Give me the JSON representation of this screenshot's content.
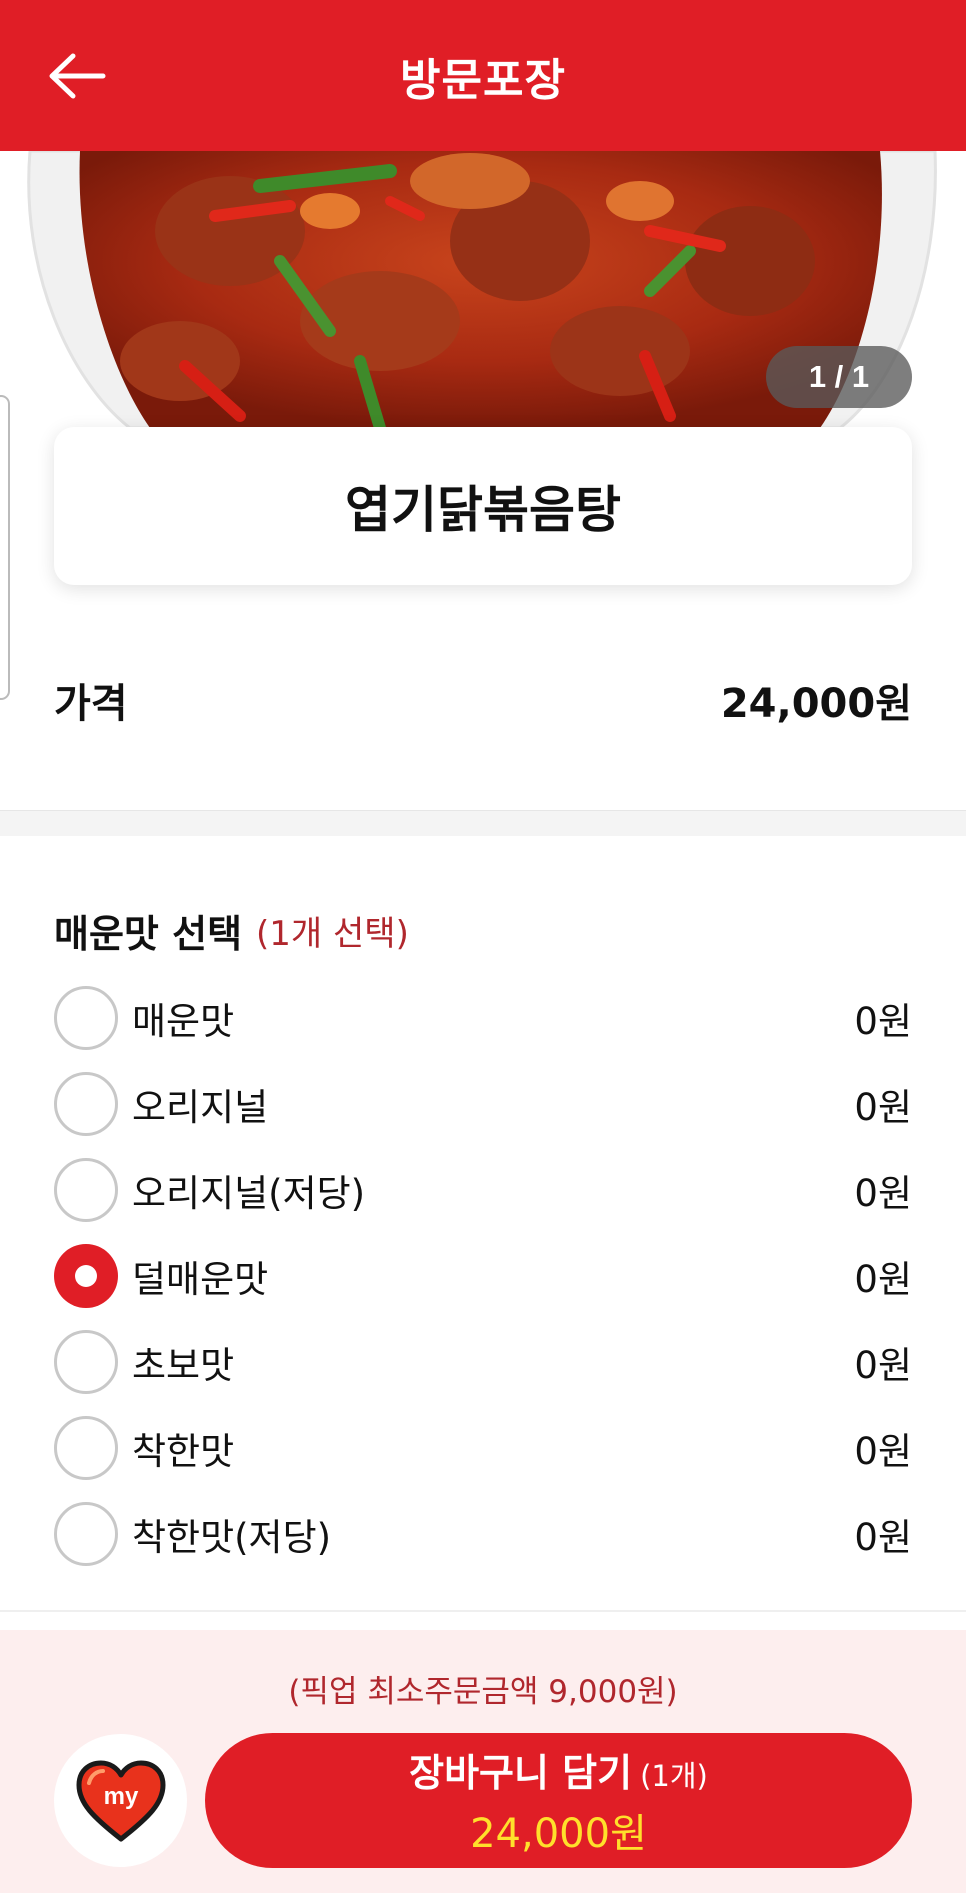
{
  "header": {
    "title": "방문포장",
    "back_icon": "arrow-left-icon"
  },
  "hero": {
    "counter": "1 / 1"
  },
  "product": {
    "name": "엽기닭볶음탕",
    "price_label": "가격",
    "price_value": "24,000원"
  },
  "options_group": {
    "title": "매운맛 선택",
    "subtitle": "(1개 선택)",
    "items": [
      {
        "label": "매운맛",
        "price": "0원",
        "selected": false
      },
      {
        "label": "오리지널",
        "price": "0원",
        "selected": false
      },
      {
        "label": "오리지널(저당)",
        "price": "0원",
        "selected": false
      },
      {
        "label": "덜매운맛",
        "price": "0원",
        "selected": true
      },
      {
        "label": "초보맛",
        "price": "0원",
        "selected": false
      },
      {
        "label": "착한맛",
        "price": "0원",
        "selected": false
      },
      {
        "label": "착한맛(저당)",
        "price": "0원",
        "selected": false
      }
    ]
  },
  "footer": {
    "min_order": "(픽업 최소주문금액 9,000원)",
    "my_label": "my",
    "cart_label": "장바구니 담기",
    "cart_count": "(1개)",
    "cart_total": "24,000원"
  },
  "colors": {
    "brand_red": "#e01e26",
    "accent_text": "#b0272d",
    "total_yellow": "#ffe02b",
    "bottom_bg": "#fdeeee"
  }
}
